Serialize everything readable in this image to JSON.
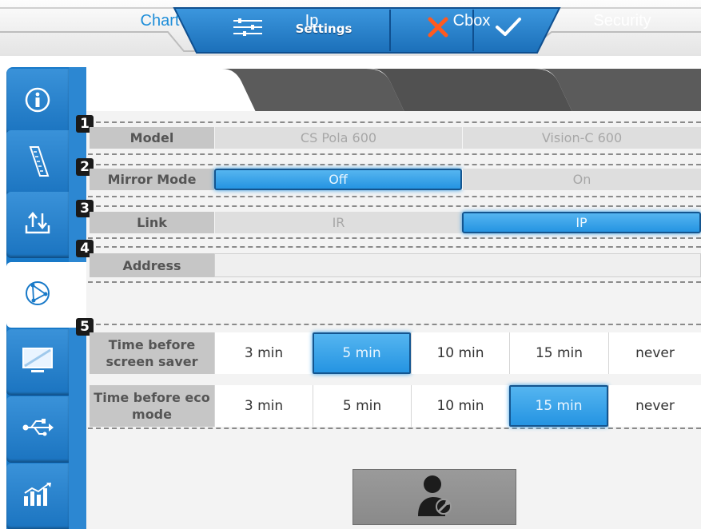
{
  "header": {
    "settings_label": "Settings",
    "icons": [
      "sliders-icon",
      "close-icon",
      "check-icon"
    ],
    "accent": "#1879c8",
    "cancel_color": "#ff5a1f"
  },
  "sidebar": {
    "items": [
      {
        "icon": "info-icon"
      },
      {
        "icon": "ruler-icon"
      },
      {
        "icon": "transfer-icon"
      },
      {
        "icon": "network-icon",
        "active": true
      },
      {
        "icon": "monitor-icon"
      },
      {
        "icon": "usb-icon"
      },
      {
        "icon": "chart-icon"
      }
    ]
  },
  "tabs": [
    {
      "label": "Chart",
      "active": true
    },
    {
      "label": "Ip"
    },
    {
      "label": "Cbox"
    },
    {
      "label": "Security"
    }
  ],
  "groups": [
    {
      "number": "1",
      "label": "Model",
      "options": [
        "CS Pola 600",
        "Vision-C 600"
      ]
    },
    {
      "number": "2",
      "label": "Mirror Mode",
      "options": [
        "Off",
        "On"
      ],
      "selected": "Off"
    },
    {
      "number": "3",
      "label": "Link",
      "options": [
        "IR",
        "IP"
      ],
      "selected": "IP"
    },
    {
      "number": "4",
      "label": "Address",
      "value": ""
    },
    {
      "number": "5"
    }
  ],
  "time": {
    "screen_saver": {
      "label_line1": "Time before",
      "label_line2": "screen saver",
      "options": [
        "3 min",
        "5 min",
        "10 min",
        "15 min",
        "never"
      ],
      "selected": "5 min"
    },
    "eco": {
      "label_line1": "Time before eco",
      "label_line2": "mode",
      "options": [
        "3 min",
        "5 min",
        "10 min",
        "15 min",
        "never"
      ],
      "selected": "15 min"
    }
  },
  "footer": {
    "icon": "user-wrench-icon"
  },
  "colors": {
    "selected": "#2594e2",
    "panel": "#f3f3f3",
    "label_bg": "#c6c6c6"
  }
}
